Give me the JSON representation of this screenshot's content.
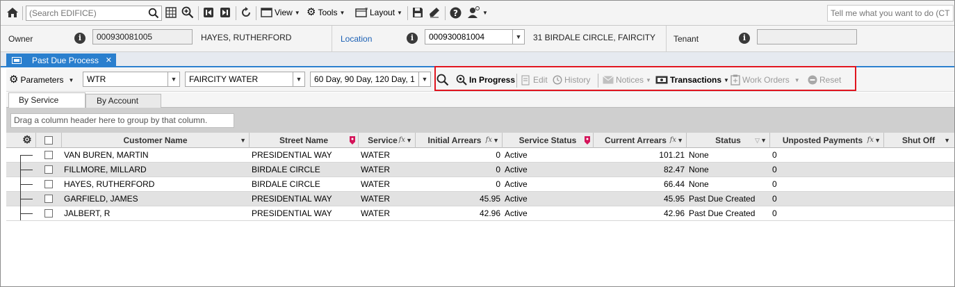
{
  "toolbar": {
    "search_placeholder": "(Search EDIFICE)",
    "view_label": "View",
    "tools_label": "Tools",
    "layout_label": "Layout",
    "tellme_placeholder": "Tell me what you want to do (CT"
  },
  "infobar": {
    "owner_label": "Owner",
    "owner_id": "000930081005",
    "owner_name": "HAYES, RUTHERFORD",
    "location_label": "Location",
    "location_id": "000930081004",
    "location_address": "31 BIRDALE CIRCLE, FAIRCITY",
    "tenant_label": "Tenant",
    "tenant_value": ""
  },
  "doc_tab": {
    "label": "Past Due Process",
    "close": "✕"
  },
  "process_toolbar": {
    "parameters_label": "Parameters",
    "service_code": "WTR",
    "utility": "FAIRCITY WATER",
    "aging": "60 Day, 90 Day, 120 Day, 1",
    "in_progress_label": "In Progress",
    "edit_label": "Edit",
    "history_label": "History",
    "notices_label": "Notices",
    "transactions_label": "Transactions",
    "work_orders_label": "Work Orders",
    "reset_label": "Reset"
  },
  "subtabs": [
    "By Service",
    "By Account"
  ],
  "group_hint": "Drag a column header here to group by that column.",
  "grid": {
    "columns": [
      "Customer Name",
      "Street Name",
      "Service",
      "Initial Arrears",
      "Service Status",
      "Current Arrears",
      "Status",
      "Unposted Payments",
      "Shut Off"
    ],
    "rows": [
      {
        "customer": "VAN BUREN, MARTIN",
        "street": "PRESIDENTIAL WAY",
        "service": "WATER",
        "initial_arrears": "0",
        "service_status": "Active",
        "current_arrears": "101.21",
        "status": "None",
        "unposted": "0",
        "shut_off": ""
      },
      {
        "customer": "FILLMORE, MILLARD",
        "street": "BIRDALE CIRCLE",
        "service": "WATER",
        "initial_arrears": "0",
        "service_status": "Active",
        "current_arrears": "82.47",
        "status": "None",
        "unposted": "0",
        "shut_off": ""
      },
      {
        "customer": "HAYES, RUTHERFORD",
        "street": "BIRDALE CIRCLE",
        "service": "WATER",
        "initial_arrears": "0",
        "service_status": "Active",
        "current_arrears": "66.44",
        "status": "None",
        "unposted": "0",
        "shut_off": ""
      },
      {
        "customer": "GARFIELD, JAMES",
        "street": "PRESIDENTIAL WAY",
        "service": "WATER",
        "initial_arrears": "45.95",
        "service_status": "Active",
        "current_arrears": "45.95",
        "status": "Past Due Created",
        "unposted": "0",
        "shut_off": ""
      },
      {
        "customer": "JALBERT, R",
        "street": "PRESIDENTIAL WAY",
        "service": "WATER",
        "initial_arrears": "42.96",
        "service_status": "Active",
        "current_arrears": "42.96",
        "status": "Past Due Created",
        "unposted": "0",
        "shut_off": ""
      }
    ]
  },
  "colors": {
    "accent_blue": "#2a7fce",
    "highlight_red": "#e0141e",
    "link_blue": "#1a5fb4"
  }
}
